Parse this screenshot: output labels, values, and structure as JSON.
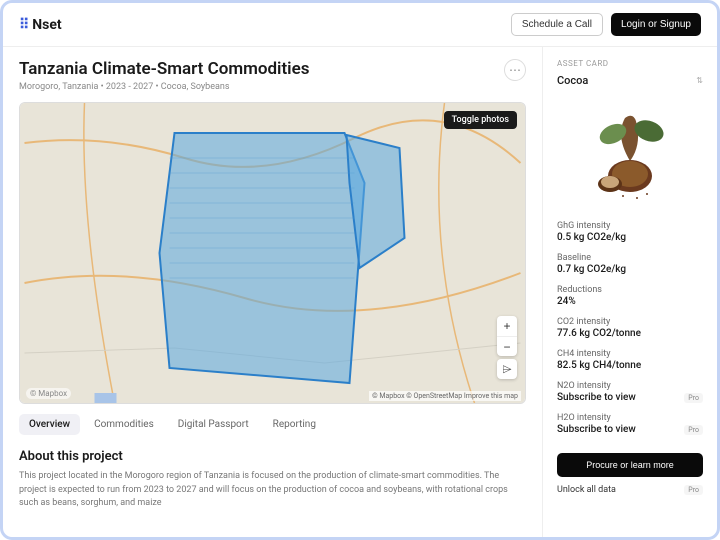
{
  "header": {
    "brand": "Nset",
    "schedule": "Schedule a Call",
    "login": "Login or Signup"
  },
  "project": {
    "title": "Tanzania Climate-Smart Commodities",
    "subtitle": "Morogoro, Tanzania • 2023 - 2027 • Cocoa, Soybeans"
  },
  "map": {
    "toggle": "Toggle photos",
    "logo": "© Mapbox",
    "attribution": "© Mapbox © OpenStreetMap Improve this map"
  },
  "tabs": [
    "Overview",
    "Commodities",
    "Digital Passport",
    "Reporting"
  ],
  "about": {
    "heading": "About this project",
    "body": "This project located in the Morogoro region of Tanzania is focused on the production of climate-smart commodities. The project is expected to run from 2023 to 2027 and will focus on the production of cocoa and soybeans, with rotational crops such as beans, sorghum, and maize"
  },
  "asset": {
    "card_label": "ASSET CARD",
    "name": "Cocoa",
    "metrics": [
      {
        "label": "GhG intensity",
        "value": "0.5 kg CO2e/kg"
      },
      {
        "label": "Baseline",
        "value": "0.7 kg CO2e/kg"
      },
      {
        "label": "Reductions",
        "value": "24%"
      },
      {
        "label": "CO2 intensity",
        "value": "77.6 kg CO2/tonne"
      },
      {
        "label": "CH4 intensity",
        "value": "82.5 kg CH4/tonne"
      }
    ],
    "locked": [
      {
        "label": "N2O intensity",
        "value": "Subscribe to view",
        "badge": "Pro"
      },
      {
        "label": "H2O intensity",
        "value": "Subscribe to view",
        "badge": "Pro"
      }
    ],
    "cta": "Procure or learn more",
    "unlock": "Unlock all data",
    "unlock_badge": "Pro"
  }
}
